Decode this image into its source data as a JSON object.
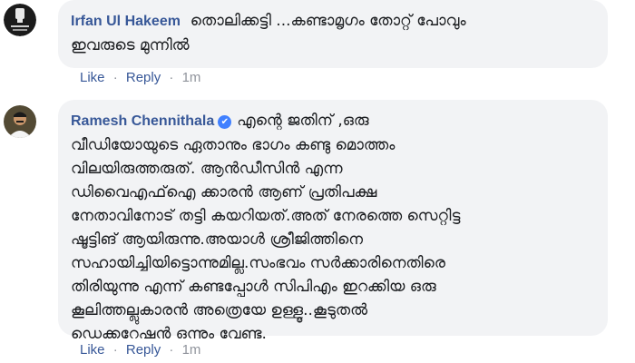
{
  "comments": [
    {
      "author": "Irfan Ul Hakeem",
      "verified": false,
      "text": "തൊലിക്കട്ടി ...കണ്ടാമൃഗം തോറ്റ് പോവും\nഇവരുടെ മുന്നിൽ",
      "actions": {
        "like": "Like",
        "reply": "Reply",
        "separator": "·",
        "time": "1m"
      }
    },
    {
      "author": "Ramesh Chennithala",
      "verified": true,
      "verified_glyph": "✔",
      "text": "എന്റെ ജതിന് ,ഒരു\nവീഡിയോയുടെ ഏതാനും ഭാഗം കണ്ടു മൊത്തം\nവിലയിരുത്തരുത്. ആൻഡീസിൻ എന്ന\nഡിവൈഎഫ്ഐ ക്കാരൻ ആണ് പ്രതിപക്ഷ\nനേതാവിനോട് തട്ടി കയറിയത്.അത് നേരത്തെ സെറ്റിട്ട\nഷൂട്ടിങ് ആയിരുന്നു.അയാൾ ശ്രീജിത്തിനെ\nസഹായിച്ചിയിട്ടൊന്നുമില്ല.സംഭവം സർക്കാരിനെതിരെ\nതിരിയുന്നു എന്ന് കണ്ടപ്പോൾ സിപിഎം ഇറക്കിയ ഒരു\nകൂലിത്തല്ലുകാരൻ അത്രെയേ ഉള്ളൂ..കൂടുതൽ\nഡെക്കറേഷൻ ഒന്നും വേണ്ട.",
      "actions": {
        "like": "Like",
        "reply": "Reply",
        "separator": "·",
        "time": "1m"
      }
    }
  ],
  "colors": {
    "link": "#385898",
    "bubble": "#f2f3f5",
    "text": "#1c1e21",
    "meta": "#90949c",
    "verified_badge": "#4080ff"
  },
  "icons": {
    "avatar_1": "profile-photo-fist-logo",
    "avatar_2": "profile-photo-person",
    "verified": "verified-badge-icon"
  }
}
